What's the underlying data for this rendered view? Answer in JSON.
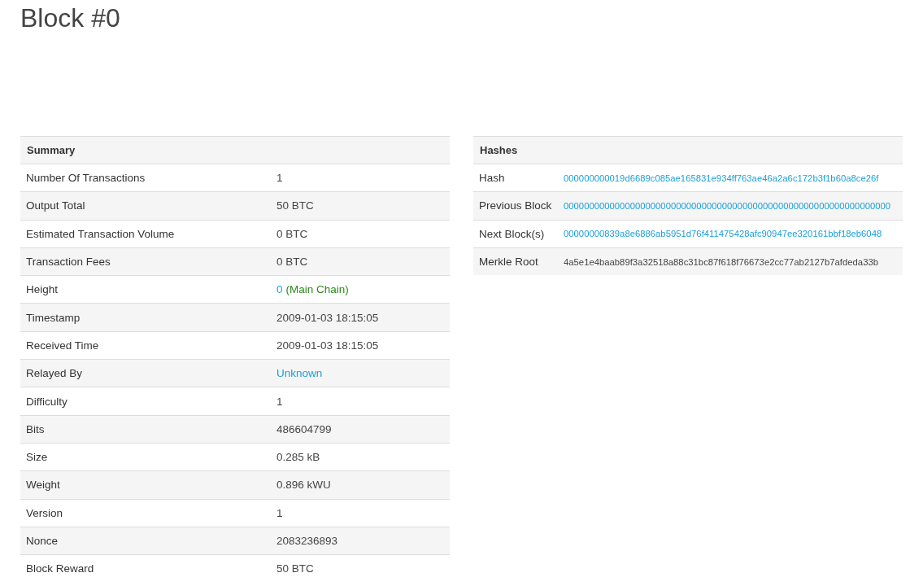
{
  "title": "Block #0",
  "summary": {
    "heading": "Summary",
    "rows": [
      {
        "label": "Number Of Transactions",
        "value": [
          {
            "text": "1",
            "kind": "plain"
          }
        ]
      },
      {
        "label": "Output Total",
        "value": [
          {
            "text": "50 BTC",
            "kind": "plain"
          }
        ]
      },
      {
        "label": "Estimated Transaction Volume",
        "value": [
          {
            "text": "0 BTC",
            "kind": "plain"
          }
        ]
      },
      {
        "label": "Transaction Fees",
        "value": [
          {
            "text": "0 BTC",
            "kind": "plain"
          }
        ]
      },
      {
        "label": "Height",
        "value": [
          {
            "text": "0",
            "kind": "link"
          },
          {
            "text": "(Main Chain)",
            "kind": "status"
          }
        ]
      },
      {
        "label": "Timestamp",
        "value": [
          {
            "text": "2009-01-03 18:15:05",
            "kind": "plain"
          }
        ]
      },
      {
        "label": "Received Time",
        "value": [
          {
            "text": "2009-01-03 18:15:05",
            "kind": "plain"
          }
        ]
      },
      {
        "label": "Relayed By",
        "value": [
          {
            "text": "Unknown",
            "kind": "link"
          }
        ]
      },
      {
        "label": "Difficulty",
        "value": [
          {
            "text": "1",
            "kind": "plain"
          }
        ]
      },
      {
        "label": "Bits",
        "value": [
          {
            "text": "486604799",
            "kind": "plain"
          }
        ]
      },
      {
        "label": "Size",
        "value": [
          {
            "text": "0.285 kB",
            "kind": "plain"
          }
        ]
      },
      {
        "label": "Weight",
        "value": [
          {
            "text": "0.896 kWU",
            "kind": "plain"
          }
        ]
      },
      {
        "label": "Version",
        "value": [
          {
            "text": "1",
            "kind": "plain"
          }
        ]
      },
      {
        "label": "Nonce",
        "value": [
          {
            "text": "2083236893",
            "kind": "plain"
          }
        ]
      },
      {
        "label": "Block Reward",
        "value": [
          {
            "text": "50 BTC",
            "kind": "plain"
          }
        ]
      }
    ]
  },
  "hashes": {
    "heading": "Hashes",
    "rows": [
      {
        "label": "Hash",
        "value": [
          {
            "text": "000000000019d6689c085ae165831e934ff763ae46a2a6c172b3f1b60a8ce26f",
            "kind": "hash-link"
          }
        ]
      },
      {
        "label": "Previous Block",
        "value": [
          {
            "text": "0000000000000000000000000000000000000000000000000000000000000000",
            "kind": "hash-link"
          }
        ]
      },
      {
        "label": "Next Block(s)",
        "value": [
          {
            "text": "00000000839a8e6886ab5951d76f411475428afc90947ee320161bbf18eb6048",
            "kind": "hash-link"
          }
        ]
      },
      {
        "label": "Merkle Root",
        "value": [
          {
            "text": "4a5e1e4baab89f3a32518a88c31bc87f618f76673e2cc77ab2127b7afdeda33b",
            "kind": "hash"
          }
        ]
      }
    ]
  }
}
